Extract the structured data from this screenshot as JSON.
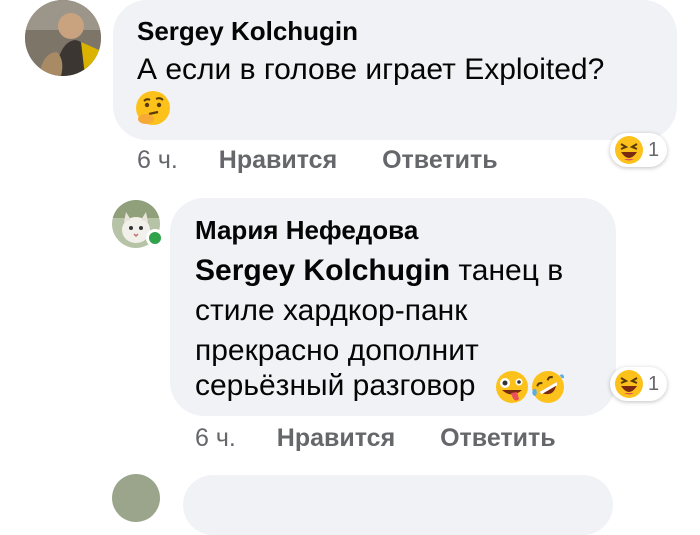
{
  "comment1": {
    "author": "Sergey Kolchugin",
    "text": "А если в голове играет Exploited?",
    "emoji_icon": "thinking-face-emoji",
    "time": "6 ч.",
    "like_label": "Нравится",
    "reply_label": "Ответить",
    "reaction_icon": "laughing-emoji",
    "reaction_count": "1"
  },
  "comment2": {
    "author": "Мария Нефедова",
    "mention": "Sergey Kolchugin",
    "lines": [
      "танец в",
      "стиле хардкор-панк",
      "прекрасно дополнит",
      "серьёзный разговор"
    ],
    "emoji_icons": [
      "zany-face-emoji",
      "rolling-laughing-emoji"
    ],
    "time": "6 ч.",
    "like_label": "Нравится",
    "reply_label": "Ответить",
    "reaction_icon": "laughing-emoji",
    "reaction_count": "1"
  },
  "colors": {
    "bubble": "#f0f2f5",
    "meta_text": "#65676b",
    "online": "#31a24c",
    "emoji_yellow": "#fcc21b"
  }
}
